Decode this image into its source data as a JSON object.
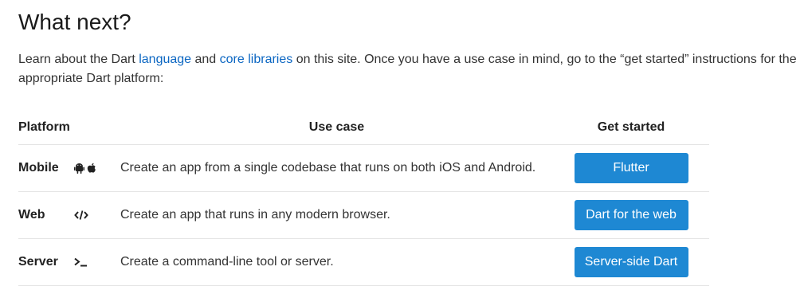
{
  "heading": "What next?",
  "intro": {
    "before_link1": "Learn about the Dart ",
    "link1": "language",
    "between": " and ",
    "link2": "core libraries",
    "after_links": " on this site. Once you have a use case in mind, go to the “get started” instructions for the appropriate Dart platform:"
  },
  "table": {
    "headers": {
      "platform": "Platform",
      "use_case": "Use case",
      "get_started": "Get started"
    },
    "rows": [
      {
        "platform": "Mobile",
        "icons": [
          "android-icon",
          "apple-icon"
        ],
        "use_case": "Create an app from a single codebase that runs on both iOS and Android.",
        "button": "Flutter"
      },
      {
        "platform": "Web",
        "icons": [
          "code-icon"
        ],
        "use_case": "Create an app that runs in any modern browser.",
        "button": "Dart for the web"
      },
      {
        "platform": "Server",
        "icons": [
          "terminal-icon"
        ],
        "use_case": "Create a command-line tool or server.",
        "button": "Server-side Dart"
      }
    ]
  },
  "colors": {
    "link": "#0b66c2",
    "button": "#1e88d3",
    "divider": "#e4e4e4"
  }
}
